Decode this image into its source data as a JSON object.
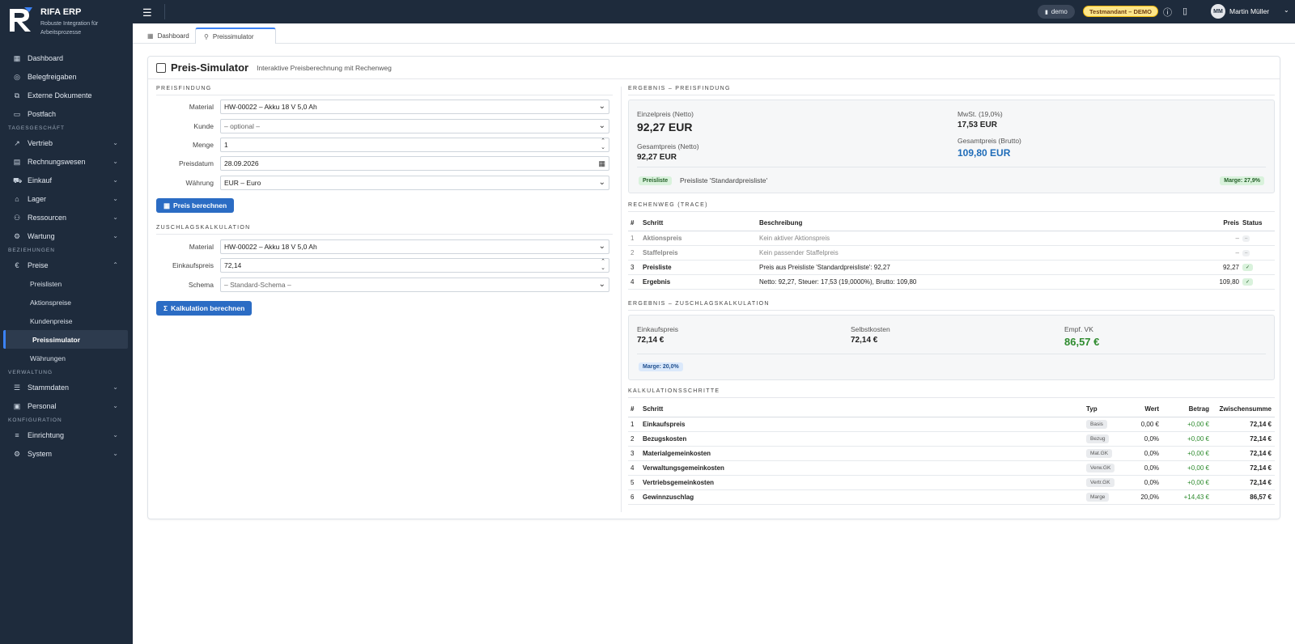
{
  "app": {
    "name": "RIFA ERP",
    "tagline": "Robuste Integration für Arbeitsprozesse"
  },
  "sidebar": {
    "top": [
      {
        "label": "Dashboard",
        "icon": "dashboard-icon"
      },
      {
        "label": "Belegfreigaben",
        "icon": "check-circle-icon"
      },
      {
        "label": "Externe Dokumente",
        "icon": "external-doc-icon"
      },
      {
        "label": "Postfach",
        "icon": "inbox-icon"
      }
    ],
    "section_tagesgeschaeft": "TAGESGESCHÄFT",
    "tages": [
      {
        "label": "Vertrieb"
      },
      {
        "label": "Rechnungswesen"
      },
      {
        "label": "Einkauf"
      },
      {
        "label": "Lager"
      },
      {
        "label": "Ressourcen"
      },
      {
        "label": "Wartung"
      }
    ],
    "section_beziehungen": "BEZIEHUNGEN",
    "preise": "Preise",
    "preise_sub": [
      "Preislisten",
      "Aktionspreise",
      "Kundenpreise",
      "Preissimulator",
      "Währungen"
    ],
    "section_verwaltung": "VERWALTUNG",
    "verwaltung": [
      {
        "label": "Stammdaten"
      },
      {
        "label": "Personal"
      }
    ],
    "section_konfiguration": "KONFIGURATION",
    "konfiguration": [
      {
        "label": "Einrichtung"
      },
      {
        "label": "System"
      }
    ]
  },
  "topbar": {
    "tenant": "demo",
    "testmandant": "Testmandant – DEMO",
    "user_initials": "MM",
    "user_name": "Martin Müller"
  },
  "tabs": [
    {
      "label": "Dashboard"
    },
    {
      "label": "Preissimulator"
    }
  ],
  "page": {
    "title": "Preis-Simulator",
    "subtitle": "Interaktive Preisberechnung mit Rechenweg"
  },
  "preisfindung": {
    "heading": "PREISFINDUNG",
    "fields": {
      "material": {
        "label": "Material",
        "value": "HW-00022 – Akku 18 V 5,0 Ah"
      },
      "kunde": {
        "label": "Kunde",
        "value": "– optional –"
      },
      "menge": {
        "label": "Menge",
        "value": "1"
      },
      "preisdatum": {
        "label": "Preisdatum",
        "value": "28.09.2026"
      },
      "waehrung": {
        "label": "Währung",
        "value": "EUR – Euro"
      }
    },
    "button": "Preis berechnen"
  },
  "zuschlag": {
    "heading": "ZUSCHLAGSKALKULATION",
    "fields": {
      "material": {
        "label": "Material",
        "value": "HW-00022 – Akku 18 V 5,0 Ah"
      },
      "einkaufspreis": {
        "label": "Einkaufspreis",
        "value": "72,14"
      },
      "schema": {
        "label": "Schema",
        "value": "– Standard-Schema –"
      }
    },
    "button": "Kalkulation berechnen"
  },
  "ergebnis_preis": {
    "heading": "ERGEBNIS – PREISFINDUNG",
    "einzelpreis_label": "Einzelpreis (Netto)",
    "einzelpreis": "92,27 EUR",
    "gesamt_netto_label": "Gesamtpreis (Netto)",
    "gesamt_netto": "92,27 EUR",
    "mwst_label": "MwSt. (19,0%)",
    "mwst": "17,53 EUR",
    "gesamt_brutto_label": "Gesamtpreis (Brutto)",
    "gesamt_brutto": "109,80 EUR",
    "badge": "Preisliste",
    "source": "Preisliste 'Standardpreisliste'",
    "marge": "Marge: 27,9%"
  },
  "rechenweg": {
    "heading": "RECHENWEG (TRACE)",
    "columns": [
      "#",
      "Schritt",
      "Beschreibung",
      "Preis",
      "Status"
    ],
    "rows": [
      {
        "n": "1",
        "schritt": "Aktionspreis",
        "beschreibung": "Kein aktiver Aktionspreis",
        "preis": "–",
        "status": "–",
        "muted": true
      },
      {
        "n": "2",
        "schritt": "Staffelpreis",
        "beschreibung": "Kein passender Staffelpreis",
        "preis": "–",
        "status": "–",
        "muted": true
      },
      {
        "n": "3",
        "schritt": "Preisliste",
        "beschreibung": "Preis aus Preisliste 'Standardpreisliste': 92,27",
        "preis": "92,27",
        "status": "✓",
        "muted": false
      },
      {
        "n": "4",
        "schritt": "Ergebnis",
        "beschreibung": "Netto: 92,27, Steuer: 17,53 (19,0000%), Brutto: 109,80",
        "preis": "109,80",
        "status": "✓",
        "muted": false
      }
    ]
  },
  "ergebnis_zuschlag": {
    "heading": "ERGEBNIS – ZUSCHLAGSKALKULATION",
    "einkaufspreis_label": "Einkaufspreis",
    "einkaufspreis": "72,14 €",
    "selbstkosten_label": "Selbstkosten",
    "selbstkosten": "72,14 €",
    "vk_label": "Empf. VK",
    "vk": "86,57 €",
    "marge": "Marge: 20,0%"
  },
  "kalkulation": {
    "heading": "KALKULATIONSSCHRITTE",
    "columns": [
      "#",
      "Schritt",
      "Typ",
      "Wert",
      "Betrag",
      "Zwischensumme"
    ],
    "rows": [
      {
        "n": "1",
        "schritt": "Einkaufspreis",
        "typ": "Basis",
        "wert": "0,00 €",
        "betrag": "+0,00 €",
        "summe": "72,14 €"
      },
      {
        "n": "2",
        "schritt": "Bezugskosten",
        "typ": "Bezug",
        "wert": "0,0%",
        "betrag": "+0,00 €",
        "summe": "72,14 €"
      },
      {
        "n": "3",
        "schritt": "Materialgemeinkosten",
        "typ": "Mat.GK",
        "wert": "0,0%",
        "betrag": "+0,00 €",
        "summe": "72,14 €"
      },
      {
        "n": "4",
        "schritt": "Verwaltungsgemeinkosten",
        "typ": "Verw.GK",
        "wert": "0,0%",
        "betrag": "+0,00 €",
        "summe": "72,14 €"
      },
      {
        "n": "5",
        "schritt": "Vertriebsgemeinkosten",
        "typ": "Vertr.GK",
        "wert": "0,0%",
        "betrag": "+0,00 €",
        "summe": "72,14 €"
      },
      {
        "n": "6",
        "schritt": "Gewinnzuschlag",
        "typ": "Marge",
        "wert": "20,0%",
        "betrag": "+14,43 €",
        "summe": "86,57 €"
      }
    ]
  }
}
